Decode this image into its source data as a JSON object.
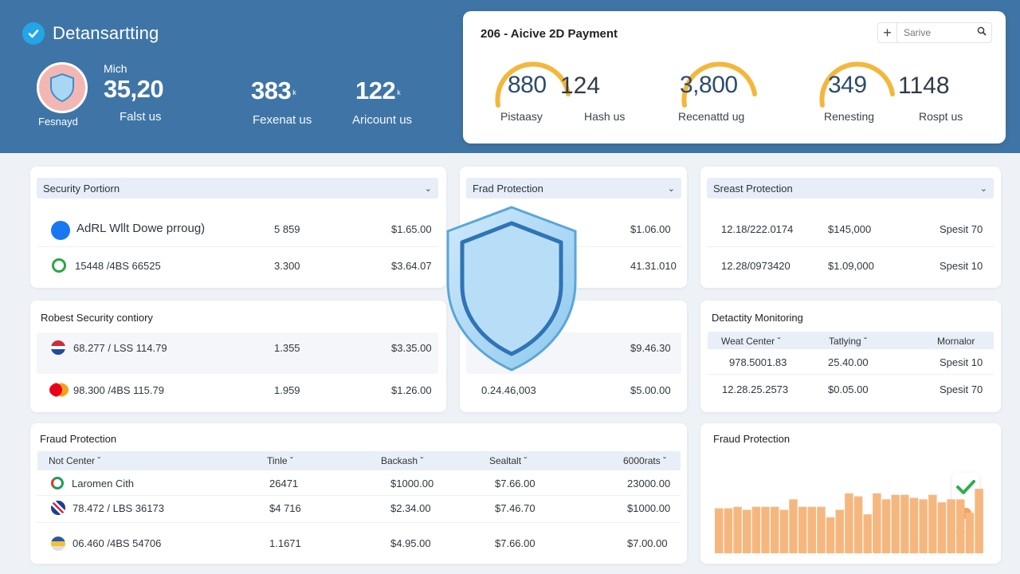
{
  "header": {
    "brand_title": "Detansartting",
    "avatar_label": "Fesnayd",
    "stats": [
      {
        "small": "Mich",
        "value": "35,20",
        "caption": "Falst us"
      },
      {
        "value": "383",
        "suffix": "k",
        "caption": "Fexenat us"
      },
      {
        "value": "122",
        "suffix": "k",
        "caption": "Aricount us"
      }
    ]
  },
  "payment": {
    "title": "206 - Aicive 2D Payment",
    "search_placeholder": "Sarive",
    "gauges": [
      {
        "value": "880",
        "fill": 0.5,
        "caption": "Pistaasy"
      },
      {
        "value": "124",
        "caption": "Hash us"
      },
      {
        "value": "3,800",
        "fill": 0.5,
        "caption": "Recenattd ug"
      },
      {
        "value": "349",
        "fill": 0.5,
        "caption": "Renesting"
      },
      {
        "value": "1148",
        "caption": "Rospt us"
      }
    ]
  },
  "security_portion": {
    "title": "Security Portiorn",
    "rows": [
      {
        "name": "AdRL Wllt Dowe prroug)",
        "count": "5 859",
        "amount": "$1.65.00"
      },
      {
        "name": "15448 /4BS 66525",
        "count": "3.300",
        "amount": "$3.64.07"
      }
    ]
  },
  "frad_protection": {
    "title": "Frad Protection",
    "rows": [
      {
        "amount": "$1.06.00"
      },
      {
        "amount": "41.31.010"
      }
    ]
  },
  "sreast_protection": {
    "title": "Sreast Protection",
    "rows": [
      {
        "id": "12.18/222.0174",
        "amount": "$145,000",
        "status": "Spesit 70"
      },
      {
        "id": "12.28/0973420",
        "amount": "$1.09,000",
        "status": "Spesit 10"
      }
    ]
  },
  "robust": {
    "title": "Robest Security contiory",
    "rows": [
      {
        "name": "68.277 / LSS 114.79",
        "count": "1.355",
        "amount": "$3.35.00"
      },
      {
        "name": "98.300 /4BS 115.79",
        "count": "1.959",
        "amount": "$1.26.00"
      }
    ]
  },
  "middle": {
    "rows": [
      {
        "left": "",
        "amount": "$9.46.30"
      },
      {
        "left": "0.24.46,003",
        "amount": "$5.00.00"
      }
    ]
  },
  "detactity": {
    "title": "Detactity Monitoring",
    "headers": [
      "Weat Center",
      "Tatlying",
      "Mornalor"
    ],
    "rows": [
      {
        "id": "978.5001.83",
        "amount": "25.40.00",
        "status": "Spesit 10"
      },
      {
        "id": "12.28.25.2573",
        "amount": "$0.05.00",
        "status": "Spesit 70"
      }
    ]
  },
  "fraud_table": {
    "title": "Fraud Protection",
    "headers": [
      "Not Center",
      "Tinle",
      "Backash",
      "Sealtalt",
      "6000rats"
    ],
    "rows": [
      {
        "name": "Laromen Cith",
        "time": "26471",
        "back": "$1000.00",
        "seal": "$7.66.00",
        "total": "23000.00"
      },
      {
        "name": "78.472 / LBS 36173",
        "time": "$4 716",
        "back": "$2.34.00",
        "seal": "$7.46.70",
        "total": "$1000.00"
      },
      {
        "name": "06.460 /4BS 54706",
        "time": "1.1671",
        "back": "$4.95.00",
        "seal": "$7.66.00",
        "total": "$7.00.00"
      }
    ]
  },
  "fraud_chart": {
    "title": "Fraud Protection"
  },
  "chart_data": {
    "type": "bar",
    "title": "Fraud Protection",
    "values": [
      60,
      60,
      62,
      58,
      62,
      62,
      62,
      58,
      72,
      62,
      62,
      62,
      48,
      58,
      80,
      76,
      52,
      80,
      72,
      78,
      78,
      74,
      72,
      78,
      68,
      72,
      72,
      54,
      86
    ],
    "ylim": [
      0,
      100
    ],
    "color": "#f6b77f"
  },
  "colors": {
    "band": "#3f75a6",
    "gauge": "#f3b73c",
    "accent": "#23a6e8"
  }
}
